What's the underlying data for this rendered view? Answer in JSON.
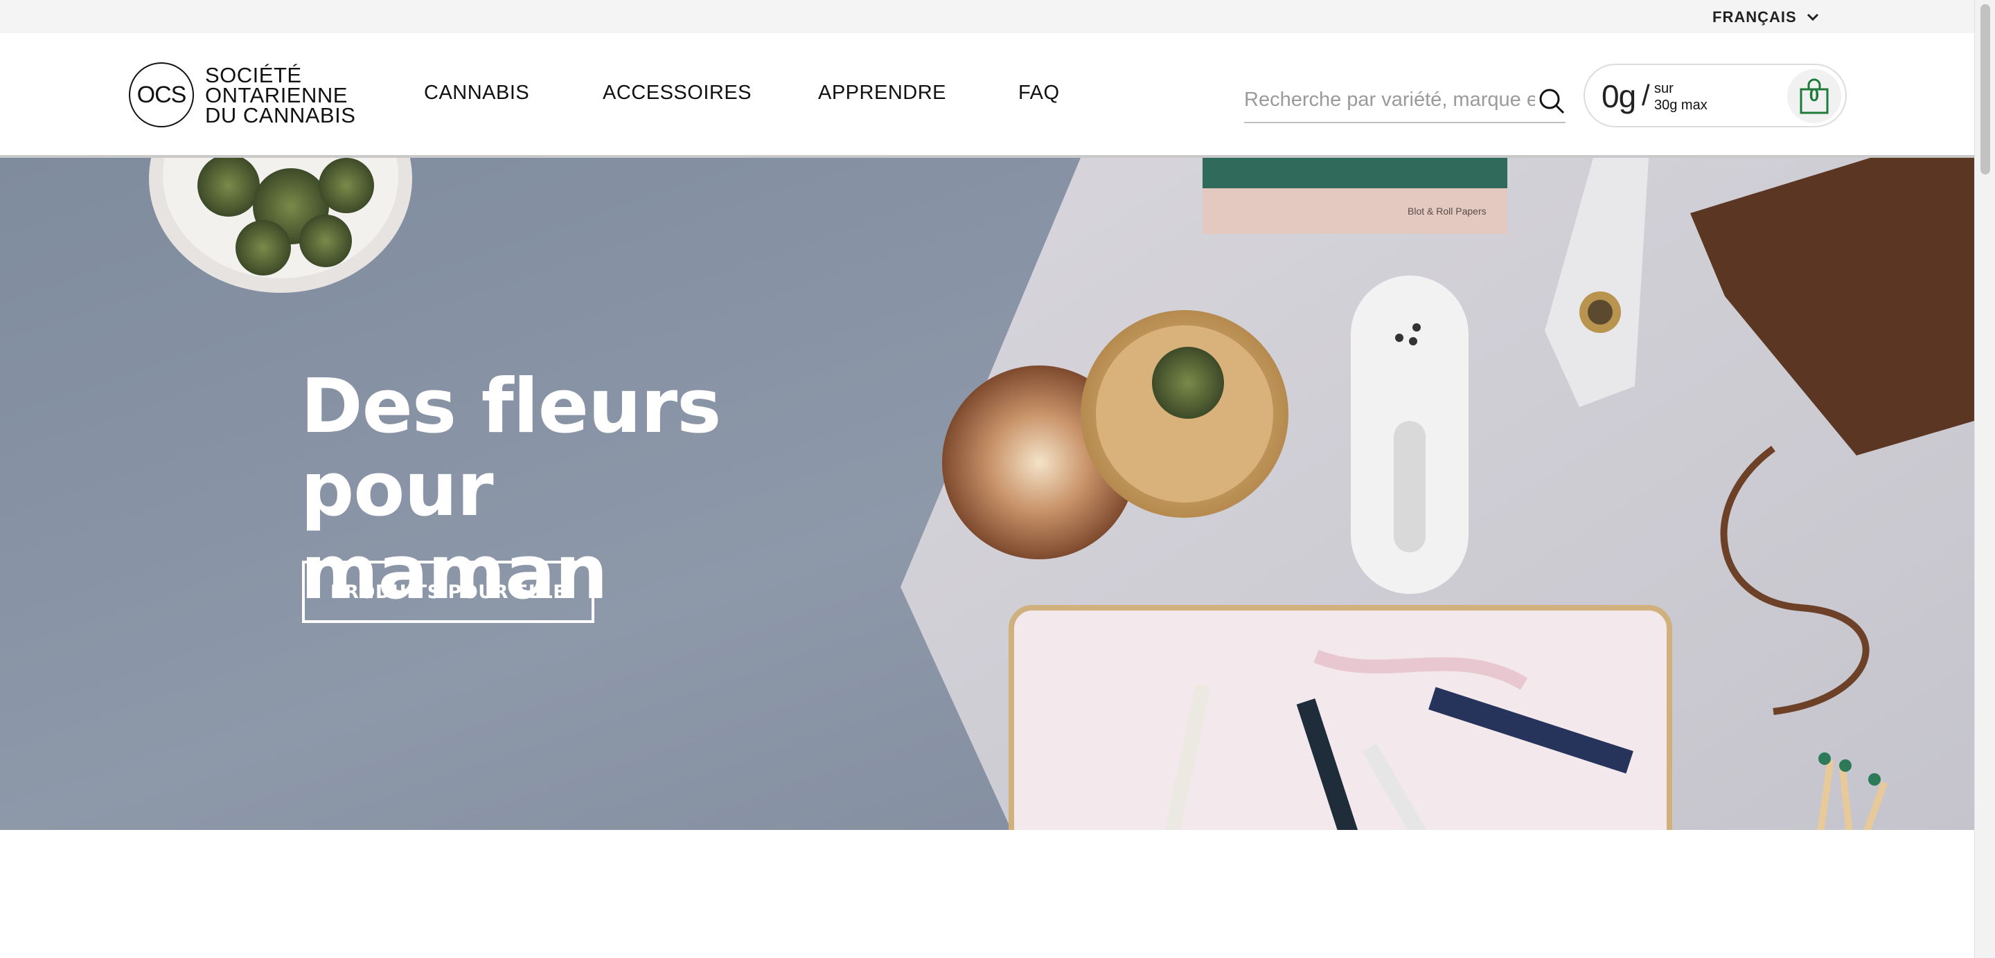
{
  "topbar": {
    "language_label": "FRANÇAIS"
  },
  "logo": {
    "mark": "OCS",
    "lines": [
      "SOCIÉTÉ",
      "ONTARIENNE",
      "DU CANNABIS"
    ]
  },
  "nav": {
    "items": [
      {
        "label": "CANNABIS"
      },
      {
        "label": "ACCESSOIRES"
      },
      {
        "label": "APPRENDRE"
      },
      {
        "label": "FAQ"
      }
    ]
  },
  "search": {
    "placeholder": "Recherche par variété, marque et plus"
  },
  "cart": {
    "amount": "0g",
    "separator": "/",
    "sub_line1": "sur",
    "sub_line2": "30g max",
    "count": "0",
    "accent": "#1f7a3a"
  },
  "hero": {
    "title_line1": "Des fleurs pour",
    "title_line2": "maman",
    "button_label": "PRODUITS POUR ELLE",
    "book_label": "Blot & Roll Papers"
  },
  "icons": {
    "language": "chevron-down-icon",
    "search": "search-icon",
    "cart": "shopping-bag-icon"
  }
}
